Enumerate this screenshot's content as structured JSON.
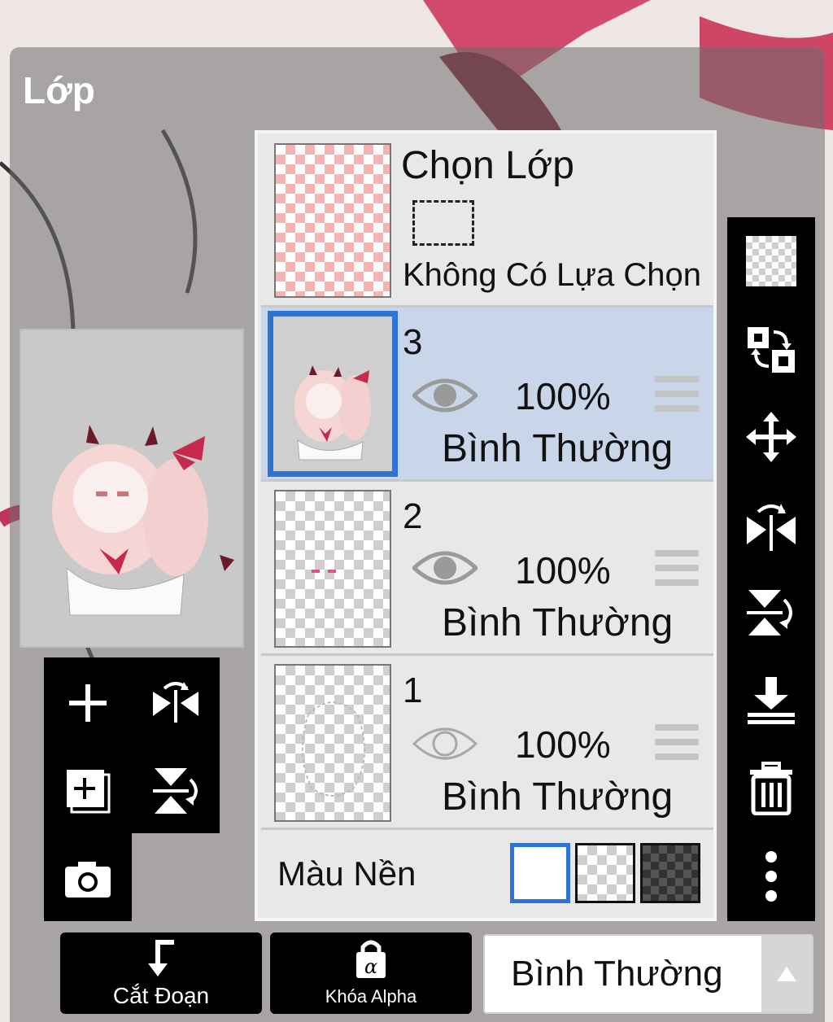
{
  "panel": {
    "title": "Lớp"
  },
  "selection_layer": {
    "title": "Chọn Lớp",
    "status": "Không Có Lựa Chọn"
  },
  "layers": [
    {
      "number": "3",
      "opacity": "100%",
      "blend": "Bình Thường",
      "visible": true,
      "selected": true
    },
    {
      "number": "2",
      "opacity": "100%",
      "blend": "Bình Thường",
      "visible": true,
      "selected": false
    },
    {
      "number": "1",
      "opacity": "100%",
      "blend": "Bình Thường",
      "visible": false,
      "selected": false
    }
  ],
  "background_color": {
    "label": "Màu Nền",
    "options": [
      "white",
      "transparent",
      "dark-checker"
    ],
    "selected": "white"
  },
  "left_tools": [
    "add-layer-icon",
    "flip-horizontal-icon",
    "add-layer-copy-icon",
    "flip-vertical-icon",
    "camera-icon"
  ],
  "right_tools": [
    "transparency-icon",
    "swap-layers-icon",
    "move-icon",
    "rotate-flip-horizontal-icon",
    "rotate-flip-vertical-icon",
    "merge-down-icon",
    "trash-icon",
    "more-options-icon"
  ],
  "bottom": {
    "clip_label": "Cắt Đoạn",
    "alpha_lock_label": "Khóa Alpha",
    "blend_mode_value": "Bình Thường"
  },
  "colors": {
    "accent": "#2f74d0",
    "selected_row": "#c9d6ea",
    "toolbar": "#000000",
    "list_bg": "#e8e8e8"
  }
}
